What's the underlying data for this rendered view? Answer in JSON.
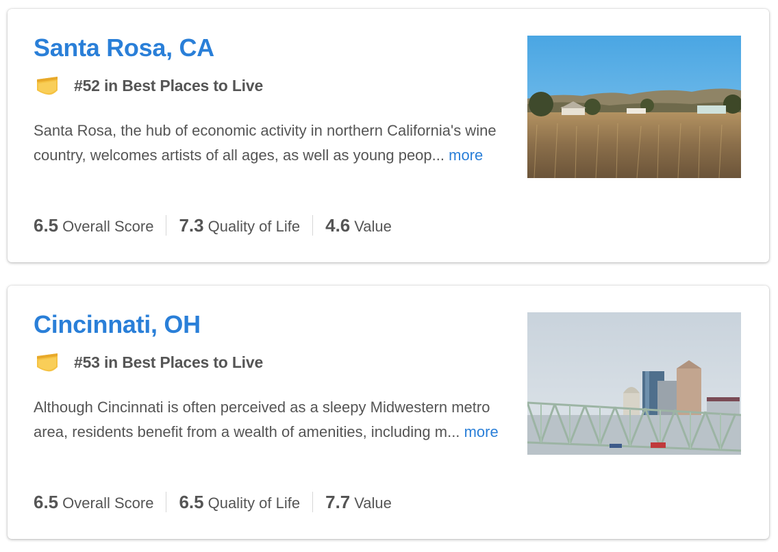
{
  "listings": [
    {
      "title": "Santa Rosa, CA",
      "rank_text": "#52 in Best Places to Live",
      "description": "Santa Rosa, the hub of economic activity in northern California's wine country, welcomes artists of all ages, as well as young peop...",
      "more_label": "more",
      "scores": [
        {
          "value": "6.5",
          "label": "Overall Score"
        },
        {
          "value": "7.3",
          "label": "Quality of Life"
        },
        {
          "value": "4.6",
          "label": "Value"
        }
      ],
      "badge_icon": "ribbon-badge-icon",
      "image": "landscape-field-hills-photo"
    },
    {
      "title": "Cincinnati, OH",
      "rank_text": "#53 in Best Places to Live",
      "description": "Although Cincinnati is often perceived as a sleepy Midwestern metro area, residents benefit from a wealth of amenities, including m...",
      "more_label": "more",
      "scores": [
        {
          "value": "6.5",
          "label": "Overall Score"
        },
        {
          "value": "6.5",
          "label": "Quality of Life"
        },
        {
          "value": "7.7",
          "label": "Value"
        }
      ],
      "badge_icon": "ribbon-badge-icon",
      "image": "city-skyline-bridge-photo"
    }
  ],
  "colors": {
    "link": "#2a7fd8",
    "text": "#555555",
    "badge": "#f5c242"
  }
}
